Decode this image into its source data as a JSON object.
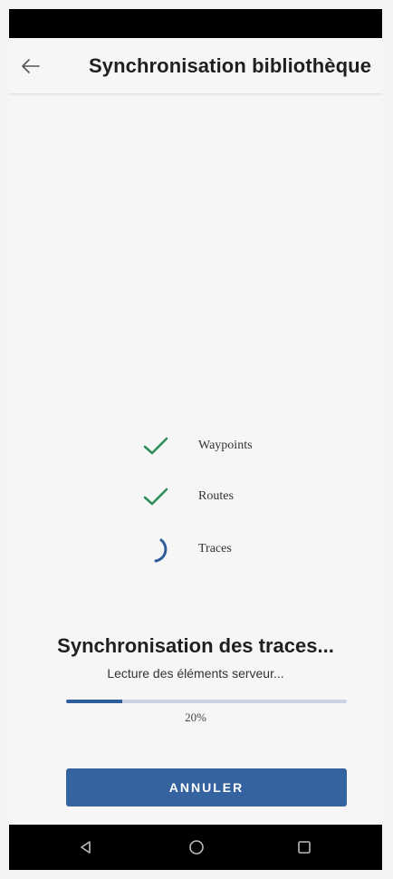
{
  "app_bar": {
    "title": "Synchronisation bibliothèque",
    "back_icon": "arrow-left-icon"
  },
  "steps": [
    {
      "label": "Waypoints",
      "state": "done",
      "icon": "check-icon"
    },
    {
      "label": "Routes",
      "state": "done",
      "icon": "check-icon"
    },
    {
      "label": "Traces",
      "state": "in-progress",
      "icon": "spinner-icon"
    }
  ],
  "progress": {
    "title": "Synchronisation des traces...",
    "subtitle": "Lecture des éléments serveur...",
    "value": 0.2,
    "percent_label": "20%"
  },
  "actions": {
    "cancel_label": "ANNULER"
  },
  "navigation": {
    "back_icon": "triangle-back-icon",
    "home_icon": "circle-home-icon",
    "recents_icon": "square-recents-icon"
  },
  "colors": {
    "accent": "#34639f",
    "check": "#2e8b5e",
    "progress_track": "#c9d3e2"
  }
}
